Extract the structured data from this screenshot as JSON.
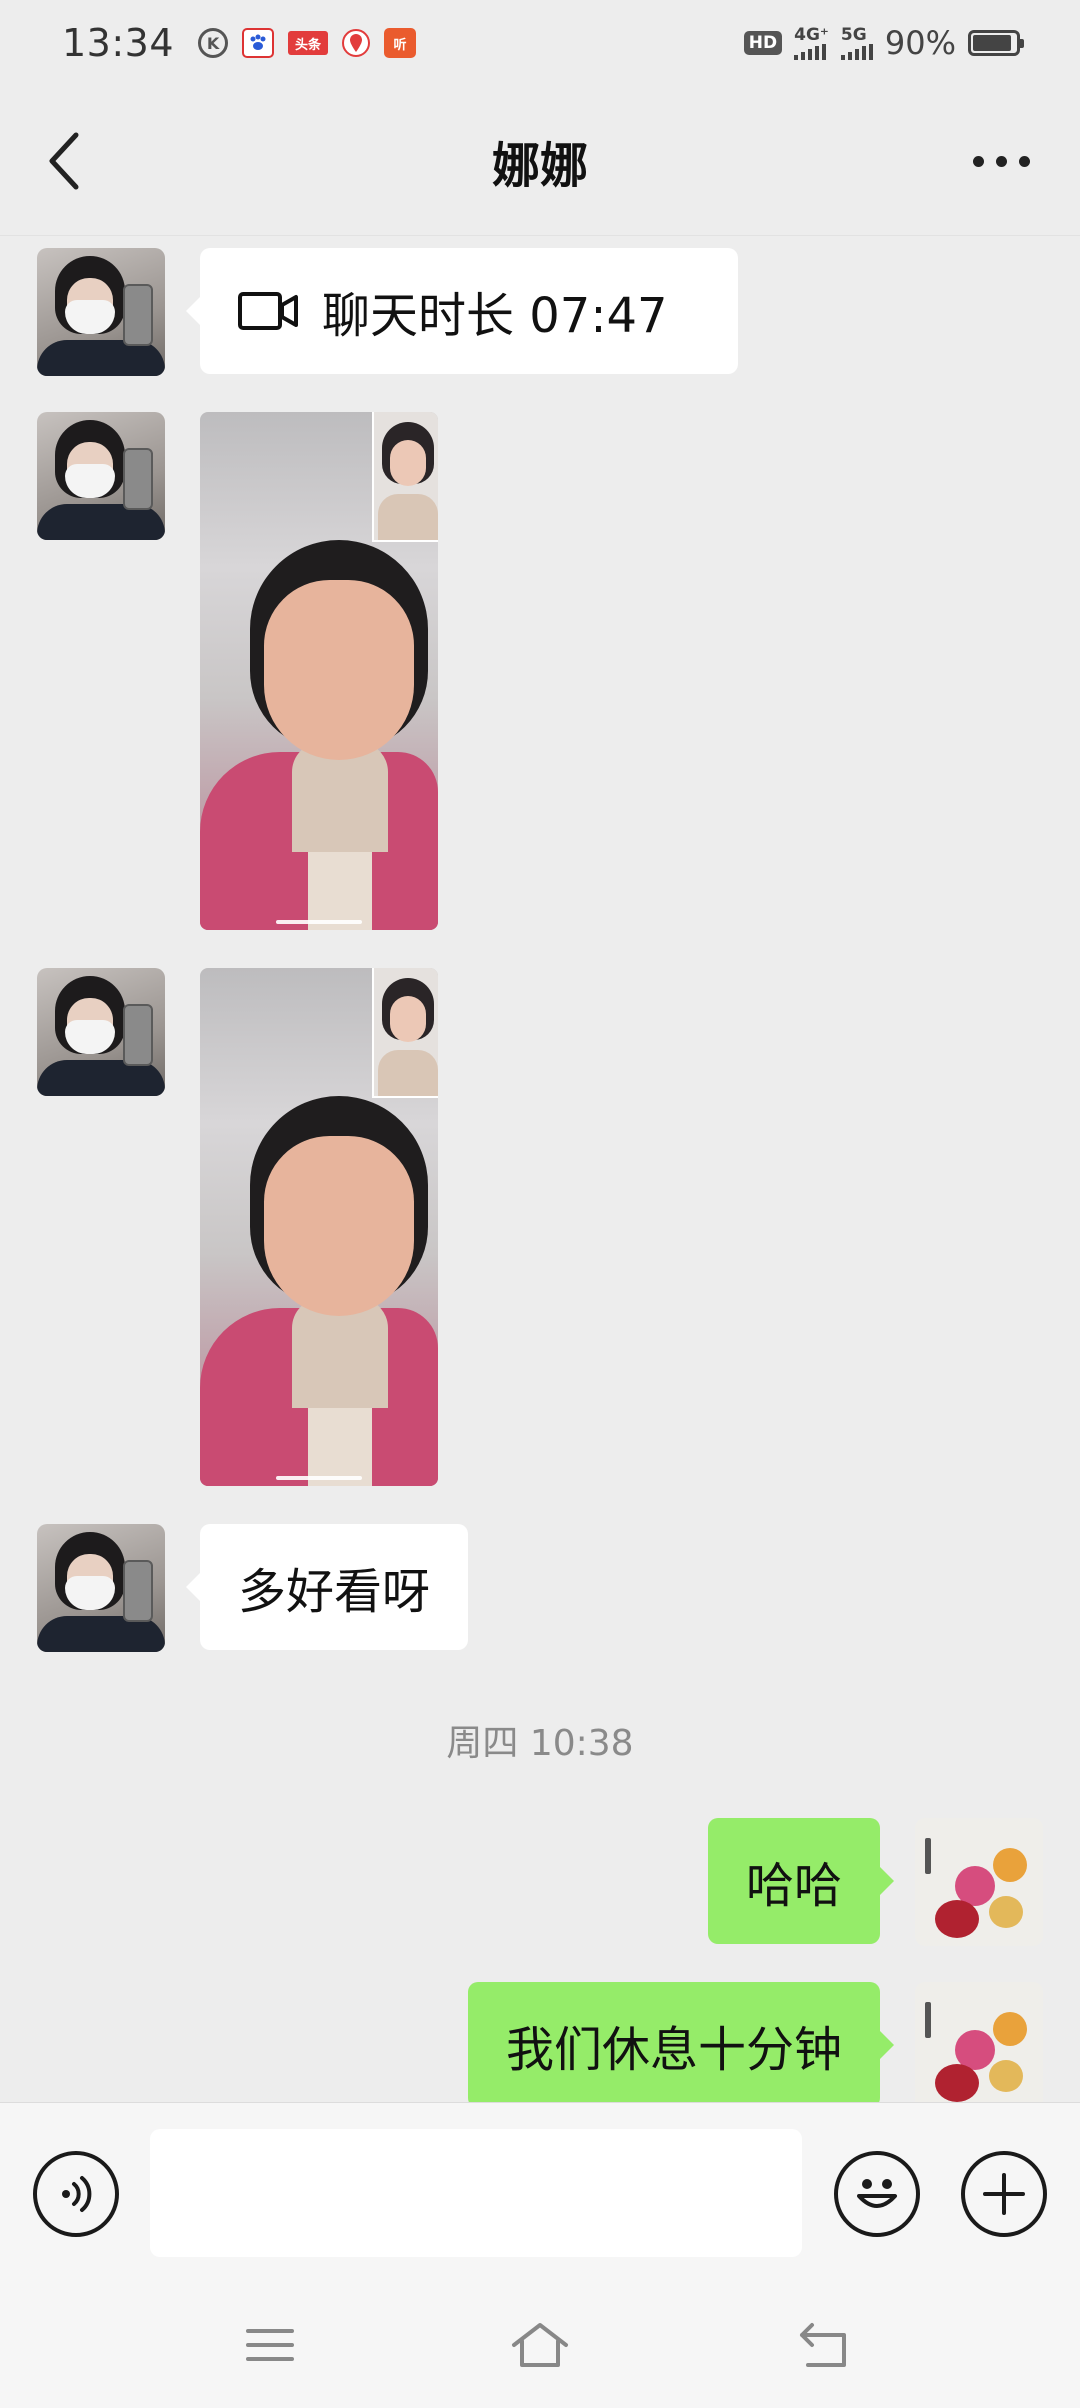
{
  "status_bar": {
    "time": "13:34",
    "app_icons": [
      "k-icon",
      "baidu-icon",
      "toutiao-icon",
      "location-pin-icon",
      "ting-icon"
    ],
    "toutiao_label": "头条",
    "ting_label": "听",
    "hd_label": "HD",
    "network_1": "4G⁺",
    "network_2": "5G",
    "battery_text": "90%",
    "battery_level": 0.9
  },
  "header": {
    "title": "娜娜",
    "back_icon": "chevron-left-icon",
    "more_icon": "more-dots-icon"
  },
  "messages": {
    "call_record": {
      "icon": "video-camera-icon",
      "text": "聊天时长 07:47"
    },
    "video_1": {
      "icon": "video-thumbnail"
    },
    "video_2": {
      "icon": "video-thumbnail"
    },
    "text_1": "多好看呀",
    "time_divider": "周四 10:38",
    "mine_1": "哈哈",
    "mine_2": "我们休息十分钟"
  },
  "input_bar": {
    "voice_icon": "voice-icon",
    "emoji_icon": "emoji-icon",
    "plus_icon": "plus-icon",
    "input_value": ""
  },
  "nav_bar": {
    "menu_icon": "menu-icon",
    "home_icon": "home-icon",
    "back_icon": "back-arrow-icon"
  },
  "colors": {
    "background": "#ededed",
    "my_bubble": "#95ec69",
    "their_bubble": "#ffffff",
    "divider_text": "#8a8a8a"
  }
}
